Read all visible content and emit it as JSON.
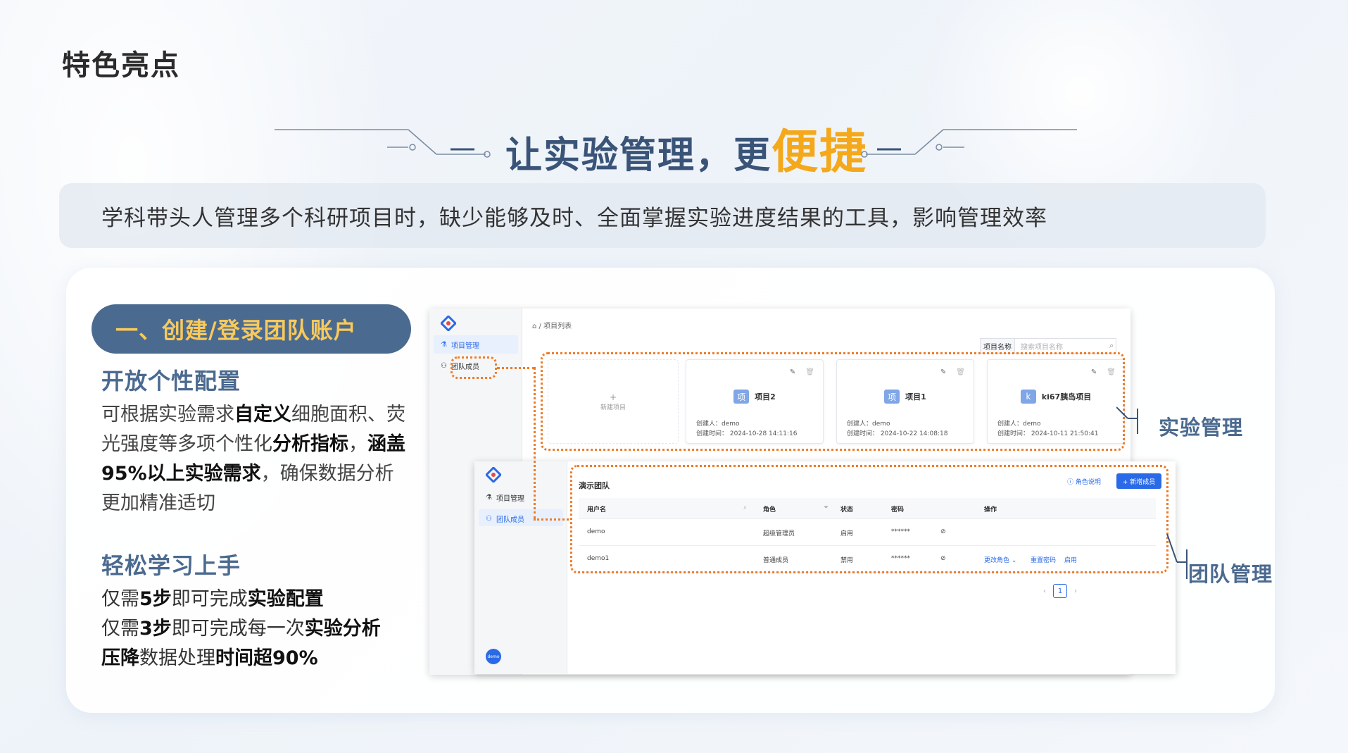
{
  "page": {
    "heading": "特色亮点",
    "title_prefix": "让实验管理，更",
    "title_highlight": "便捷",
    "pain_point": "学科带头人管理多个科研项目时，缺少能够及时、全面掌握实验进度结果的工具，影响管理效率"
  },
  "step": {
    "label": "一、创建/登录团队账户"
  },
  "feature1": {
    "title": "开放个性配置",
    "parts": [
      "可根据实验需求",
      "自定义",
      "细胞面积、荧光强度等多项个性化",
      "分析指标",
      "，",
      "涵盖95%以上实验需求",
      "，确保数据分析更加精准适切"
    ]
  },
  "feature2": {
    "title": "轻松学习上手",
    "line1": [
      "仅需",
      "5步",
      "即可完成",
      "实验配置"
    ],
    "line2": [
      "仅需",
      "3步",
      "即可完成每一次",
      "实验分析"
    ],
    "line3": [
      "压降",
      "数据处理",
      "时间超90%"
    ]
  },
  "shot1": {
    "nav": [
      "项目管理",
      "团队成员"
    ],
    "breadcrumb": "项目列表",
    "search_label": "项目名称",
    "search_placeholder": "搜索项目名称",
    "new_project": "新建项目",
    "projects": [
      {
        "badge": "项",
        "name": "项目2",
        "creator": "创建人：demo",
        "time": "创建时间：  2024-10-28 14:11:16"
      },
      {
        "badge": "项",
        "name": "项目1",
        "creator": "创建人：demo",
        "time": "创建时间：  2024-10-22 14:08:18"
      },
      {
        "badge": "k",
        "name": "ki67胰岛项目",
        "creator": "创建人：demo",
        "time": "创建时间：  2024-10-11 21:50:41"
      }
    ]
  },
  "shot2": {
    "nav": [
      "项目管理",
      "团队成员"
    ],
    "team_title": "演示团队",
    "role_help": "角色说明",
    "add_member": "+ 新增成员",
    "columns": [
      "用户名",
      "角色",
      "状态",
      "密码",
      "操作"
    ],
    "rows": [
      {
        "user": "demo",
        "role": "超级管理员",
        "status": "启用",
        "pwd": "******",
        "actions": []
      },
      {
        "user": "demo1",
        "role": "普通成员",
        "status": "禁用",
        "pwd": "******",
        "actions": [
          "更改角色",
          "重置密码",
          "启用"
        ]
      }
    ],
    "page": "1",
    "avatar": "demo"
  },
  "callouts": {
    "experiment": "实验管理",
    "team": "团队管理"
  },
  "colors": {
    "accent": "#f4a81a",
    "primary": "#4b6a8f",
    "dotted": "#ee7c2a",
    "link": "#2a6ae8"
  }
}
